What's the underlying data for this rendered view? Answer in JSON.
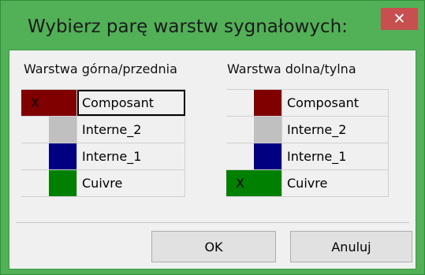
{
  "dialog": {
    "title": "Wybierz parę warstw sygnałowych:",
    "close_glyph": "✕",
    "ok_label": "OK",
    "cancel_label": "Anuluj"
  },
  "top_layers": {
    "heading": "Warstwa górna/przednia",
    "rows": [
      {
        "name": "Composant",
        "color": "#800000",
        "mark": "X",
        "selected": true
      },
      {
        "name": "Interne_2",
        "color": "#c0c0c0",
        "mark": "",
        "selected": false
      },
      {
        "name": "Interne_1",
        "color": "#000080",
        "mark": "",
        "selected": false
      },
      {
        "name": "Cuivre",
        "color": "#008000",
        "mark": "",
        "selected": false
      }
    ]
  },
  "bottom_layers": {
    "heading": "Warstwa dolna/tylna",
    "rows": [
      {
        "name": "Composant",
        "color": "#800000",
        "mark": "",
        "selected": false
      },
      {
        "name": "Interne_2",
        "color": "#c0c0c0",
        "mark": "",
        "selected": false
      },
      {
        "name": "Interne_1",
        "color": "#000080",
        "mark": "",
        "selected": false
      },
      {
        "name": "Cuivre",
        "color": "#008000",
        "mark": "X",
        "selected": true
      }
    ]
  }
}
